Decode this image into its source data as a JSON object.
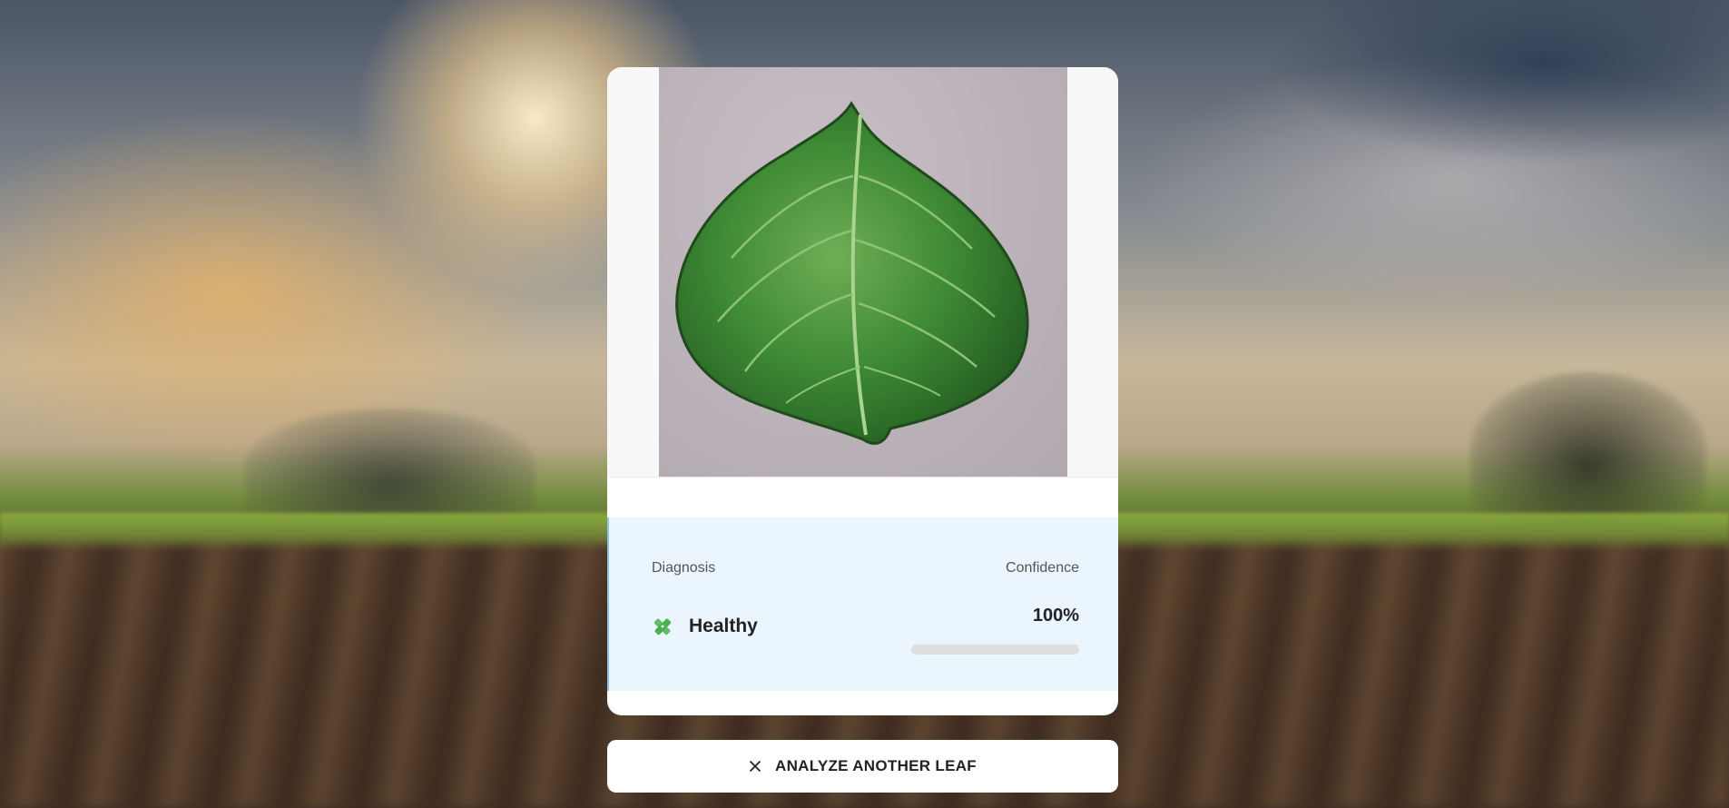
{
  "background": {
    "icon": "blurred-farm-field-background"
  },
  "preview": {
    "icon": "potato-leaf-photo"
  },
  "result": {
    "diagnosis_label": "Diagnosis",
    "confidence_label": "Confidence",
    "diagnosis_value": "Healthy",
    "diagnosis_icon": "healthy-leaf-icon",
    "confidence_value": "100%",
    "confidence_fraction": 1.0,
    "accent_color": "#4caf50"
  },
  "actions": {
    "analyze_another_label": "ANALYZE ANOTHER LEAF",
    "analyze_another_icon": "close-icon"
  }
}
